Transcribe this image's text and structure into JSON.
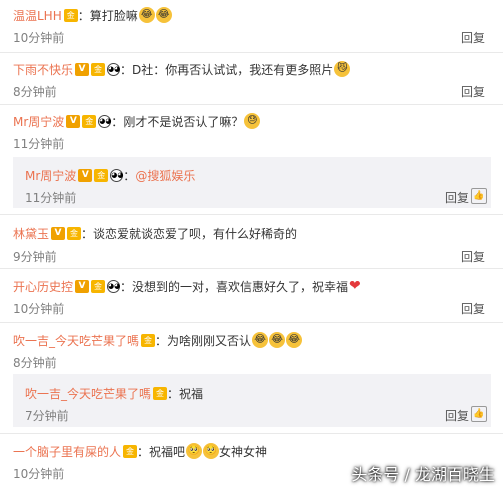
{
  "comments": [
    {
      "name": "温温LHH",
      "sep": "：",
      "text": "算打脸嘛",
      "time": "10分钟前",
      "reply": "回复"
    },
    {
      "name": "下雨不快乐",
      "sep": "：",
      "text": "D社：你再否认试试，我还有更多照片",
      "time": "8分钟前",
      "reply": "回复"
    },
    {
      "name": "Mr周宁波",
      "sep": "：",
      "text": "刚才不是说否认了嘛？",
      "time": "11分钟前",
      "reply": "回复"
    },
    {
      "name": "林黛玉",
      "sep": "：",
      "text": "谈恋爱就谈恋爱了呗，有什么好稀奇的",
      "time": "9分钟前",
      "reply": "回复"
    },
    {
      "name": "开心历史控",
      "sep": "：",
      "text": "没想到的一对，喜欢信惠好久了，祝幸福",
      "time": "10分钟前",
      "reply": "回复"
    },
    {
      "name": "吹一吉_今天吃芒果了嗎",
      "sep": "：",
      "text": "为啥刚刚又否认",
      "time": "8分钟前",
      "reply": "回复"
    },
    {
      "name": "一个脑子里有屎的人",
      "sep": "：",
      "text": "祝福吧",
      "text2": "女神女神",
      "time": "10分钟前",
      "reply": "回复"
    }
  ],
  "subreplies": [
    {
      "name": "Mr周宁波",
      "sep": "：",
      "mention": "@搜狐娱乐",
      "time": "11分钟前",
      "reply": "回复"
    },
    {
      "name": "吹一吉_今天吃芒果了嗎",
      "sep": "：",
      "text": "祝福",
      "time": "7分钟前",
      "reply": "回复"
    }
  ],
  "badges": {
    "vip": "V",
    "gold": "金",
    "panda": "◕◕"
  },
  "watermark": "头条号 / 龙湖百晓生",
  "colors": {
    "name": "#eb7350",
    "mention": "#eb7350",
    "heart": "#e4393c"
  }
}
